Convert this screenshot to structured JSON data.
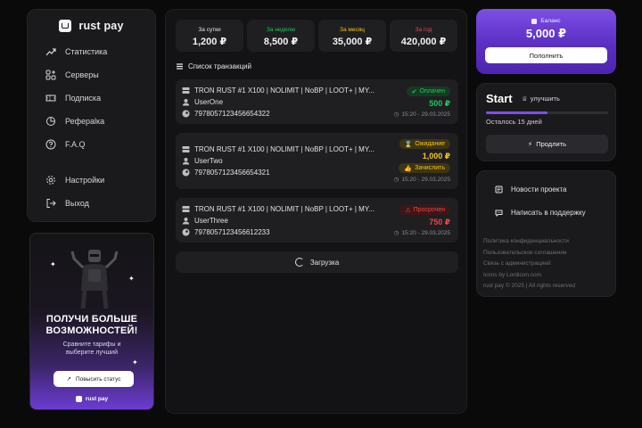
{
  "brand": {
    "name": "rust pay"
  },
  "nav": {
    "items": [
      {
        "label": "Статистика",
        "icon": "chart-line-icon"
      },
      {
        "label": "Серверы",
        "icon": "grid-plus-icon"
      },
      {
        "label": "Подписка",
        "icon": "ticket-icon"
      },
      {
        "label": "Реферalка"
      },
      {
        "label": "F.A.Q",
        "icon": "question-icon"
      },
      {
        "label": "Настройки",
        "icon": "gear-icon"
      },
      {
        "label": "Выход",
        "icon": "logout-icon"
      }
    ]
  },
  "promo": {
    "title_line1": "ПОЛУЧИ БОЛЬШЕ",
    "title_line2": "ВОЗМОЖНОСТЕЙ!",
    "sub_line1": "Сравните тарифы и",
    "sub_line2": "выберите лучший",
    "button": "Повысить статус",
    "logo": "rust pay"
  },
  "stats": [
    {
      "label": "За сутки",
      "value": "1,200 ₽",
      "color": "#e8e8ea"
    },
    {
      "label": "За неделю",
      "value": "8,500 ₽",
      "color": "#22c55e"
    },
    {
      "label": "За месяц",
      "value": "35,000 ₽",
      "color": "#f5c518"
    },
    {
      "label": "За год",
      "value": "420,000 ₽",
      "color": "#ef4444"
    }
  ],
  "transactions_title": "Список транзакций",
  "transactions": [
    {
      "title": "TRON RUST #1 X100 | NOLIMIT | NoBP | LOOT+ | MY...",
      "user": "UserOne",
      "id": "7978057123456654322",
      "status": "Оплачен",
      "status_color": "#22c55e",
      "amount": "500 ₽",
      "time": "15:20 - 29.03.2025"
    },
    {
      "title": "TRON RUST #1 X100 | NOLIMIT | NoBP | LOOT+ | MY...",
      "user": "UserTwo",
      "id": "7978057123456654321",
      "status": "Ожидание",
      "status_color": "#f5c518",
      "amount": "1,000 ₽",
      "action": "Зачислить",
      "time": "15:20 - 29.03.2025"
    },
    {
      "title": "TRON RUST #1 X100 | NOLIMIT | NoBP | LOOT+ | MY...",
      "user": "UserThree",
      "id": "7978057123456612233",
      "status": "Просрочен",
      "status_color": "#ef4444",
      "amount": "750 ₽",
      "time": "15:20 - 29.03.2025"
    }
  ],
  "load_more": "Загрузка",
  "balance": {
    "label": "Баланс",
    "value": "5,000 ₽",
    "button": "Пополнить"
  },
  "plan": {
    "name": "Start",
    "upgrade": "улучшить",
    "remaining": "Осталось 15 дней",
    "progress": 0.5,
    "extend": "Продлить"
  },
  "links": [
    {
      "label": "Новости проекта",
      "icon": "newspaper-icon"
    },
    {
      "label": "Написать в поддержку",
      "icon": "chat-icon"
    }
  ],
  "footer": [
    "Политика конфиденциальности",
    "Пользовательское соглашение",
    "Связь с администрацией",
    "Icons by Lordicon.com",
    "rust pay © 2025 | All rights reserved"
  ]
}
